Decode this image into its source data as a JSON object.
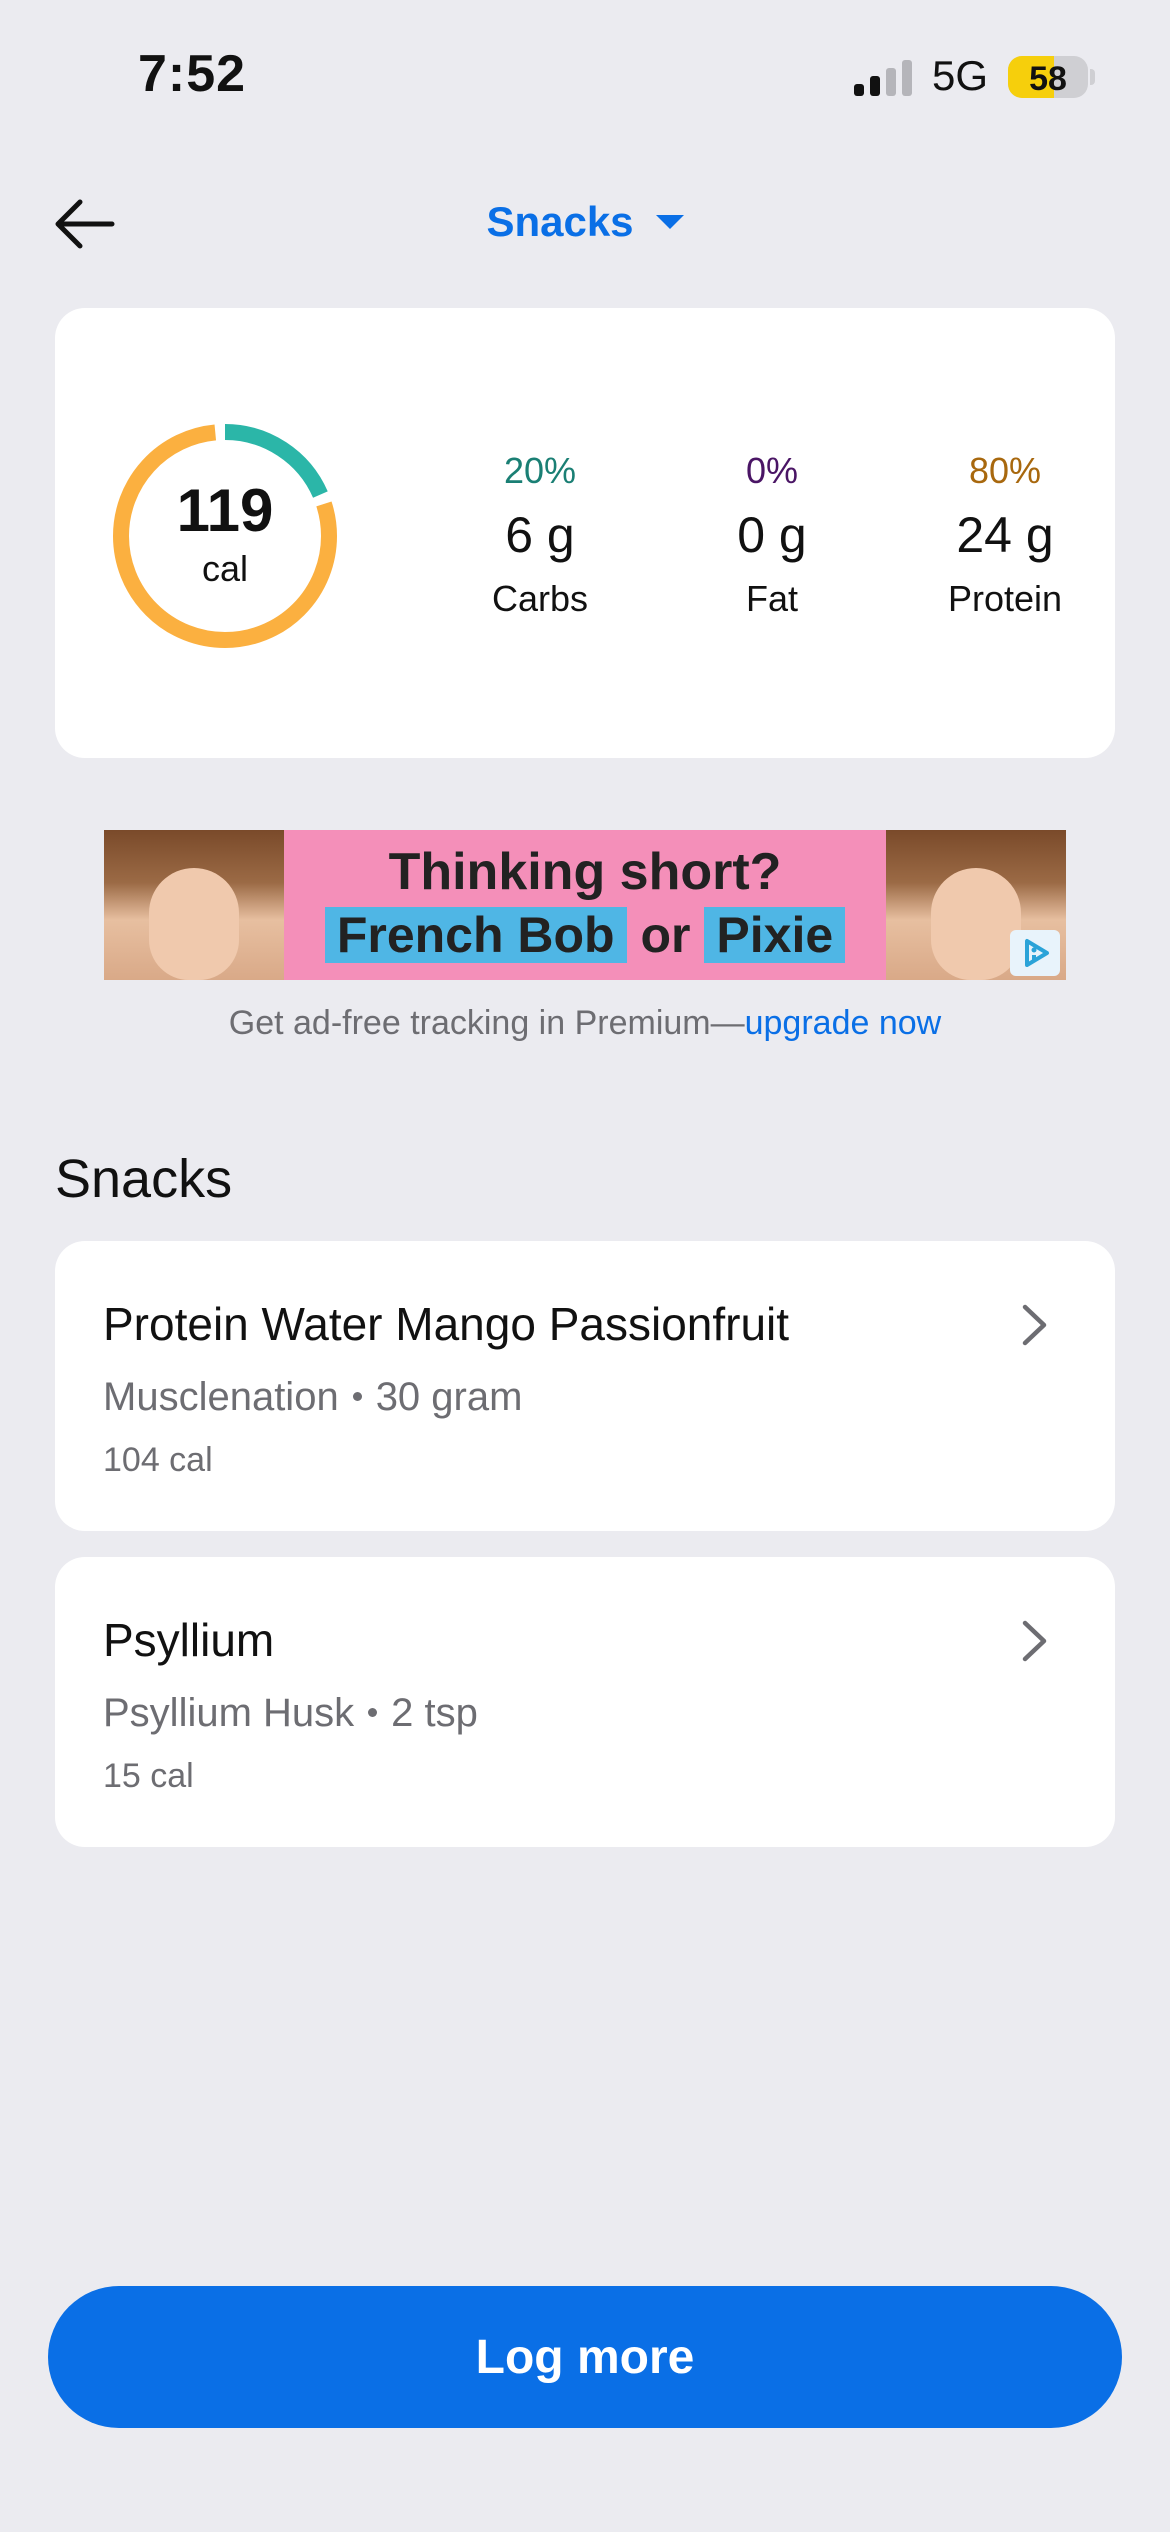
{
  "status_bar": {
    "time": "7:52",
    "network": "5G",
    "battery": "58",
    "icons": [
      "signal-icon",
      "battery-icon"
    ]
  },
  "nav": {
    "title": "Snacks",
    "icons": [
      "back-arrow-icon",
      "caret-down-icon"
    ]
  },
  "summary": {
    "calories": "119",
    "calories_unit": "cal",
    "ring": {
      "carbs_fraction": 0.2,
      "protein_fraction": 0.8,
      "colors": {
        "carbs": "#2bb6a8",
        "protein": "#fbb040"
      }
    },
    "macros": [
      {
        "pct": "20%",
        "value": "6 g",
        "label": "Carbs",
        "color": "#1a7f74"
      },
      {
        "pct": "0%",
        "value": "0 g",
        "label": "Fat",
        "color": "#4a1565"
      },
      {
        "pct": "80%",
        "value": "24 g",
        "label": "Protein",
        "color": "#a8680e"
      }
    ]
  },
  "ad": {
    "line1": "Thinking short?",
    "line2_a": "French Bob",
    "line2_b": "or",
    "line2_c": "Pixie",
    "note": "Get ad-free tracking in Premium—",
    "note_link": "upgrade now",
    "icons": [
      "adchoices-icon"
    ]
  },
  "section_title": "Snacks",
  "items": [
    {
      "name": "Protein Water Mango Passionfruit",
      "brand": "Musclenation",
      "serving": "30 gram",
      "calories": "104 cal"
    },
    {
      "name": "Psyllium",
      "brand": "Psyllium Husk",
      "serving": "2 tsp",
      "calories": "15 cal"
    }
  ],
  "log_more_label": "Log more",
  "colors": {
    "accent": "#0a6fe6",
    "background": "#ebebf0"
  }
}
